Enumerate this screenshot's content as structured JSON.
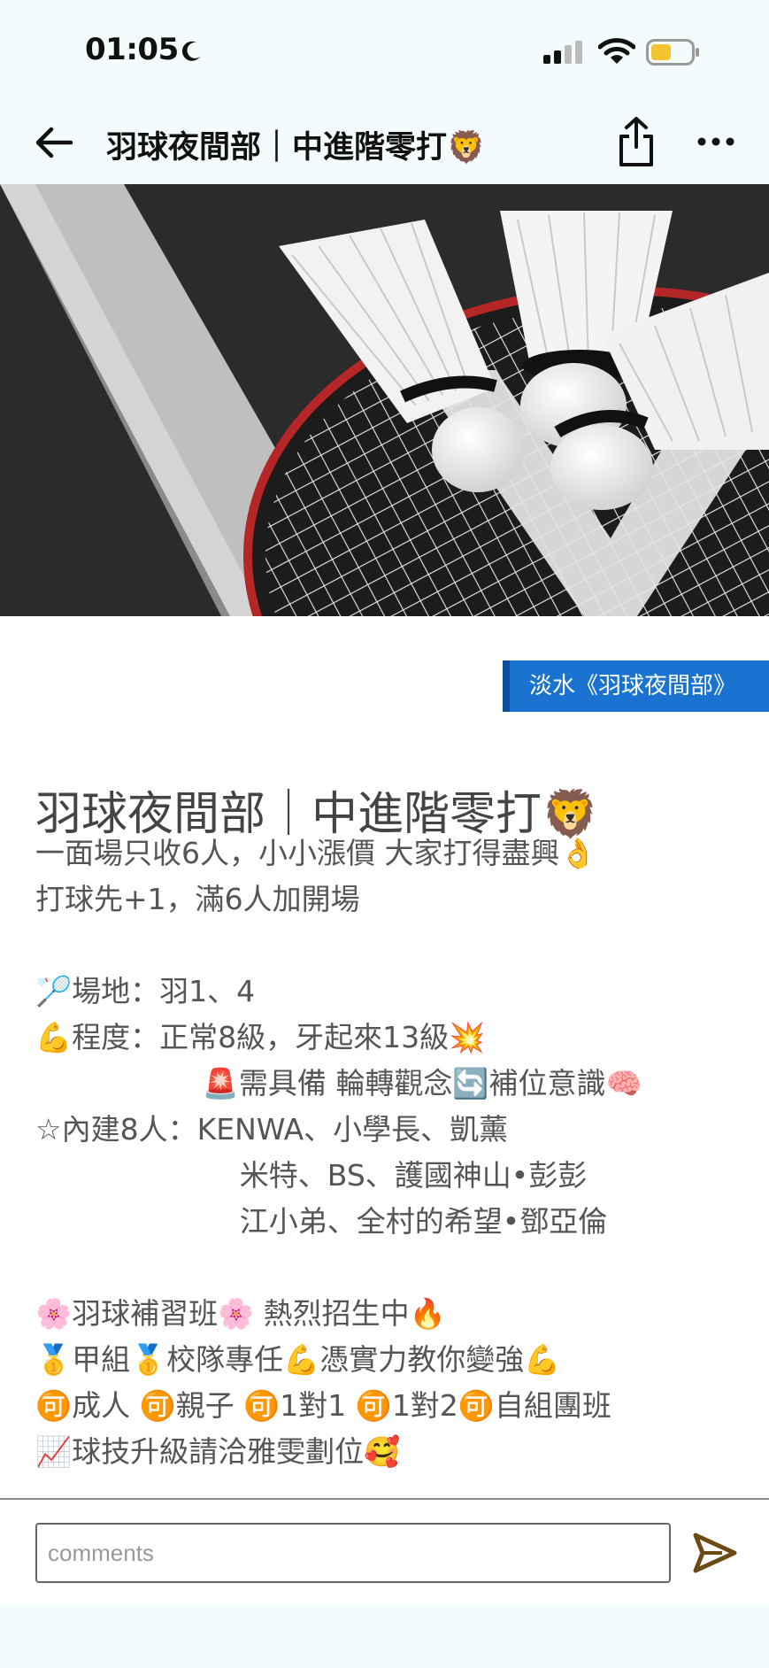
{
  "status_bar": {
    "time": "01:05"
  },
  "nav": {
    "title": "羽球夜間部｜中進階零打🦁"
  },
  "tag": {
    "label": "淡水《羽球夜間部》"
  },
  "post": {
    "title": "羽球夜間部｜中進階零打🦁",
    "lines": [
      "一面場只收6人，小小漲價 大家打得盡興👌",
      "打球先+1，滿6人加開場",
      "",
      "🏸場地：羽1、4",
      "💪程度：正常8級，牙起來13級💥",
      "                  🚨需具備 輪轉觀念🔄補位意識🧠",
      "☆內建8人：KENWA、小學長、凱薰",
      "                      米特、BS、護國神山•彭彭",
      "                      江小弟、全村的希望•鄧亞倫",
      "",
      "🌸羽球補習班🌸 熱烈招生中🔥",
      "🥇甲組🥇校隊專任💪憑實力教你變強💪",
      "🉑成人 🉑親子 🉑1對1 🉑1對2🉑自組團班",
      "📈球技升級請洽雅雯劃位🥰"
    ]
  },
  "comment": {
    "placeholder": "comments",
    "value": ""
  },
  "icons": {
    "back": "arrow-left-icon",
    "share": "share-icon",
    "more": "more-horizontal-icon",
    "send": "send-icon",
    "moon": "moon-icon",
    "signal": "cellular-signal-icon",
    "wifi": "wifi-icon",
    "battery": "battery-icon"
  },
  "colors": {
    "header_bg": "#f4fbfd",
    "tag_bg": "#1a73d1",
    "send_icon": "#6b4a14"
  }
}
